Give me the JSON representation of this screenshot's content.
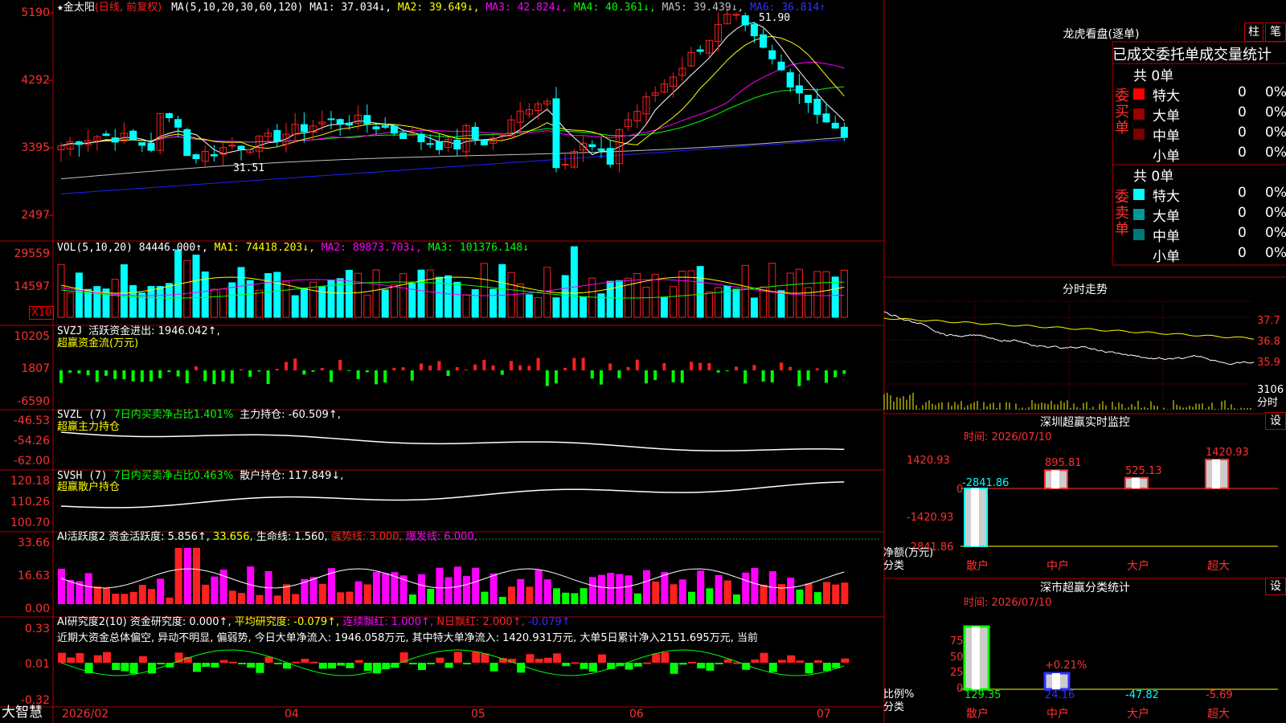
{
  "app": {
    "brand": "大智慧"
  },
  "header": {
    "star": "★",
    "stock_name": "金太阳",
    "mode": "(日线, 前复权)",
    "ma_label": "MA(5,10,20,30,60,120)",
    "ma1": "MA1: 37.034↓,",
    "ma2": "MA2: 39.649↓,",
    "ma3": "MA3: 42.824↓,",
    "ma4": "MA4: 40.361↓,",
    "ma5": "MA5: 39.439↓,",
    "ma6": "MA6: 36.814↑",
    "high_mark": "51.90",
    "low_mark": "31.51",
    "colors": {
      "ma1": "#ffffff",
      "ma2": "#ffff00",
      "ma3": "#ff00ff",
      "ma4": "#00ff00",
      "ma5": "#c0c0c0",
      "ma6": "#0000ff"
    }
  },
  "price_axis": [
    "5190",
    "4292",
    "3395",
    "2497"
  ],
  "vol": {
    "label": "VOL(5,10,20)",
    "value": "84446.000↑,",
    "ma1": "MA1: 74418.203↓,",
    "ma2": "MA2: 89873.703↓,",
    "ma3": "MA3: 101376.148↓",
    "axis": [
      "29559",
      "14597"
    ],
    "unit": "X10"
  },
  "svzj": {
    "label": "SVZJ",
    "text": "活跃资金进出: 1946.042↑,",
    "sub": "超赢资金流(万元)",
    "axis": [
      "10205",
      "1807",
      "-6590"
    ]
  },
  "svzl": {
    "label": "SVZL (7)",
    "text1": "7日内买卖净占比1.401%",
    "text2": "主力持仓: -60.509↑,",
    "sub": "超赢主力持仓",
    "axis": [
      "-46.53",
      "-54.26",
      "-62.00"
    ]
  },
  "svsh": {
    "label": "SVSH (7)",
    "text1": "7日内买卖净占比0.463%",
    "text2": "散户持仓: 117.849↓,",
    "sub": "超赢散户持仓",
    "axis": [
      "120.18",
      "110.26",
      "100.70"
    ]
  },
  "ai_active": {
    "label": "AI活跃度2",
    "t1": "资金活跃度: 5.856↑,",
    "t2": "33.656,",
    "t3": "生命线: 1.560,",
    "t4": "强势线: 3.000,",
    "t5": "爆发线: 6.000,",
    "axis": [
      "33.66",
      "16.63",
      "0.00"
    ]
  },
  "ai_research": {
    "label": "AI研究度2(10)",
    "t1": "资金研究度: 0.000↑,",
    "t2": "平均研究度: -0.079↑,",
    "t3": "连续飘红: 1.000↑,",
    "t4": "N日飘红: 2.000↑,",
    "t5": "-0.079↑",
    "desc": "近期大资金总体偏空, 异动不明显, 偏弱势, 今日大单净流入: 1946.058万元, 其中特大单净流入: 1420.931万元, 大单5日累计净入2151.695万元, 当前",
    "axis": [
      "0.33",
      "0.01",
      "-0.32"
    ]
  },
  "date_axis": [
    "2026/02",
    "04",
    "05",
    "06",
    "07"
  ],
  "right": {
    "dragon_title": "龙虎看盘(逐单)",
    "btn_bar": "柱",
    "btn_pen": "笔",
    "stat_title": "已成交委托单成交量统计",
    "buy_label": "委买单",
    "sell_label": "委卖单",
    "buy_total": "共 0单",
    "sell_total": "共 0单",
    "buy_rows": [
      {
        "name": "特大",
        "val": "0",
        "pct": "0%",
        "color": "#ff0000"
      },
      {
        "name": "大单",
        "val": "0",
        "pct": "0%",
        "color": "#990000"
      },
      {
        "name": "中单",
        "val": "0",
        "pct": "0%",
        "color": "#770000"
      },
      {
        "name": "小单",
        "val": "0",
        "pct": "0%",
        "color": "#000000"
      }
    ],
    "sell_rows": [
      {
        "name": "特大",
        "val": "0",
        "pct": "0%",
        "color": "#00ffff"
      },
      {
        "name": "大单",
        "val": "0",
        "pct": "0%",
        "color": "#009999"
      },
      {
        "name": "中单",
        "val": "0",
        "pct": "0%",
        "color": "#007777"
      },
      {
        "name": "小单",
        "val": "0",
        "pct": "0%",
        "color": "#000000"
      }
    ],
    "intraday_title": "分时走势",
    "intraday_axis": [
      "37.7",
      "36.8",
      "35.9",
      "3106",
      "分时"
    ],
    "monitor_title": "深圳超赢实时监控",
    "monitor_setting": "设",
    "monitor_time": "时间: 2026/07/10",
    "monitor_axis": [
      "1420.93",
      "0",
      "-1420.93",
      "-2841.86"
    ],
    "monitor_unit": "净额(万元)",
    "monitor_cat": "分类",
    "monitor_bars": [
      {
        "cat": "散户",
        "value": -2841.86,
        "label": "-2841.86"
      },
      {
        "cat": "中户",
        "value": 895.81,
        "label": "895.81"
      },
      {
        "cat": "大户",
        "value": 525.13,
        "label": "525.13"
      },
      {
        "cat": "超大",
        "value": 1420.93,
        "label": "1420.93"
      }
    ],
    "class_title": "深市超赢分类统计",
    "class_setting": "设",
    "class_time": "时间: 2026/07/10",
    "class_axis": [
      "75",
      "50",
      "25",
      "0"
    ],
    "class_unit": "比例%",
    "class_cat": "分类",
    "class_bar_label": "+0.21%",
    "class_values": [
      "129.35",
      "24.16",
      "-47.82",
      "-5.69"
    ],
    "class_cats": [
      "散户",
      "中户",
      "大户",
      "超大"
    ]
  }
}
